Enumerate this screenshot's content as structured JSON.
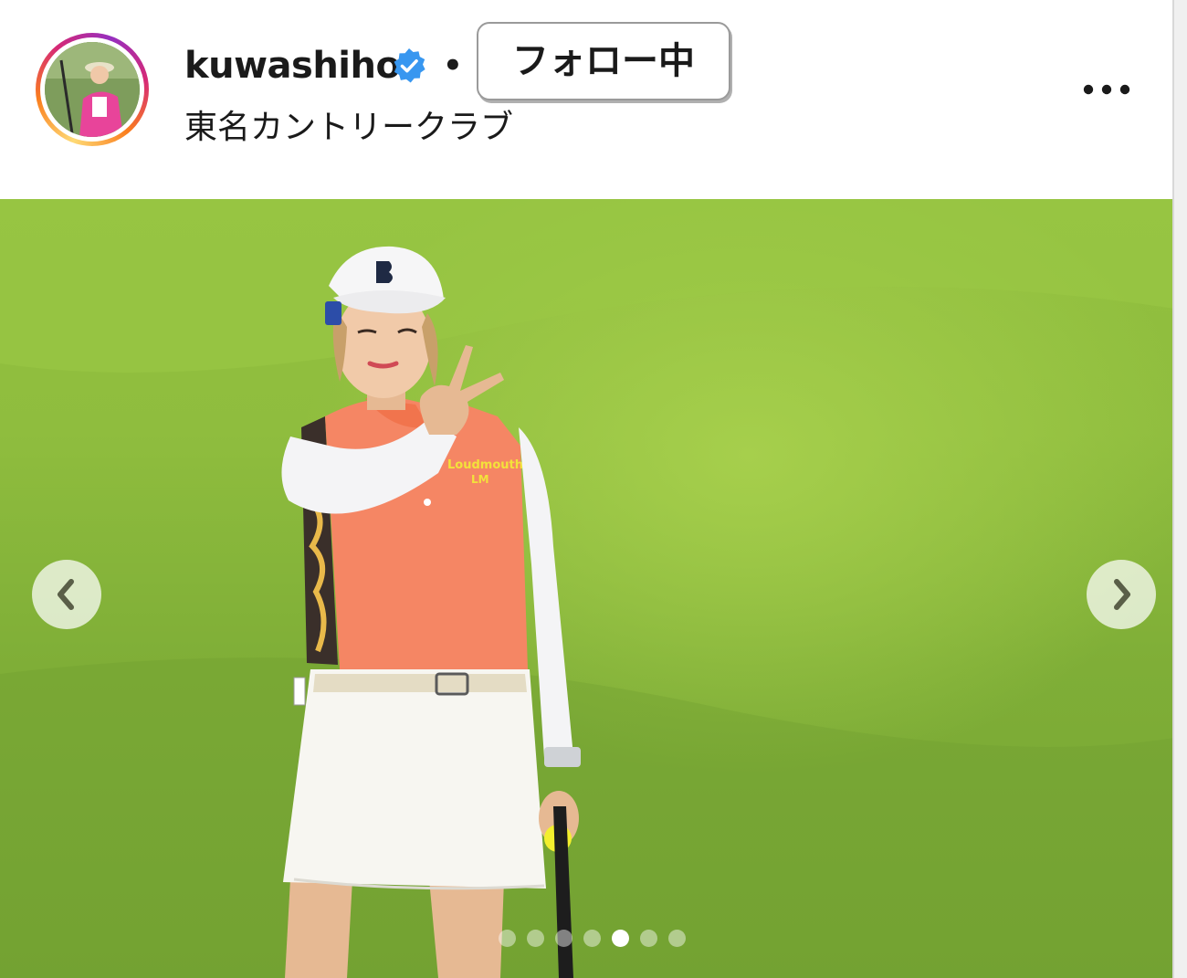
{
  "post": {
    "author": {
      "username": "kuwashiho",
      "verified": true,
      "avatar_icon": "profile-photo-golfer-pink"
    },
    "separator": "•",
    "follow_button_label": "フォロー中",
    "location": "東名カントリークラブ",
    "more_icon": "more-horizontal-icon",
    "media": {
      "description_icon": "golfer-photo",
      "prev_icon": "chevron-left-icon",
      "next_icon": "chevron-right-icon",
      "carousel": {
        "total": 7,
        "active_index": 4
      }
    }
  },
  "colors": {
    "verified_badge": "#3897f0",
    "story_ring_start": "#feda75",
    "story_ring_end": "#962fbf",
    "grass": "#8fbd3e"
  }
}
